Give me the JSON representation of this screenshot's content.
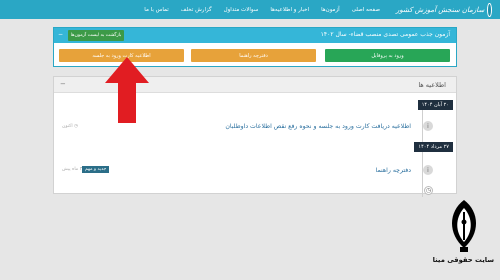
{
  "nav": {
    "logo_text": "سازمان سنجش آموزش کشور",
    "items": [
      "صفحه اصلی",
      "آزمون‌ها",
      "اخبار و اطلاعیه‌ها",
      "سوالات متداول",
      "گزارش تخلف",
      "تماس با ما"
    ]
  },
  "exam": {
    "title": "آزمون جذب عمومی تصدی منصب قضاء- سال ۱۴۰۲",
    "back_label": "بازگشت به لیست آزمون‌ها",
    "collapse": "−",
    "btn_profile": "ورود به پروفایل",
    "btn_guide": "دفترچه راهنما",
    "btn_card": "اطلاعیه کارت ورود به جلسه"
  },
  "news": {
    "title": "اطلاعیه ها",
    "collapse": "−",
    "items": [
      {
        "date": "۲۰ آبان ۱۴۰۴",
        "title": "اطلاعیه دریافت کارت ورود به جلسه و نحوه رفع نقص اطلاعات داوطلبان",
        "time": "اکنون",
        "badge": ""
      },
      {
        "date": "۲۷ مرداد ۱۴۰۴",
        "title": "دفترچه راهنما",
        "time": "۳ ماه پیش",
        "badge": "جدید و مهم"
      }
    ]
  },
  "brand": {
    "text": "سایت حقوقی مینا"
  },
  "colors": {
    "nav": "#2aa7c5",
    "green": "#28a657",
    "orange": "#e7a23a",
    "arrow": "#e11d22"
  }
}
